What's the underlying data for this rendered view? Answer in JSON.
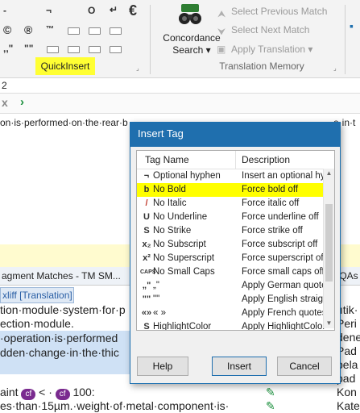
{
  "ribbon": {
    "quickinsert": {
      "label": "QuickInsert",
      "symbols_row1": [
        "-",
        "¬",
        "O",
        "↵",
        "€"
      ],
      "symbols_row2": [
        "©",
        "®",
        "™"
      ],
      "symbols_row3": [
        ",,\"",
        "\"\"",
        "«»"
      ]
    },
    "concordance": {
      "label_line1": "Concordance",
      "label_line2": "Search"
    },
    "translation_memory": {
      "label": "Translation Memory",
      "items": [
        "Select Previous Match",
        "Select Next Match",
        "Apply Translation"
      ]
    }
  },
  "editor": {
    "row_number": "2",
    "source_text": "on·is·performed·on·the·rear·b",
    "source_text_right": "e·in·t",
    "panel_title": "agment Matches - TM SM...",
    "panel_tab_right": "TQAs",
    "file_tab": "xliff [Translation]",
    "segments": [
      "tion·module·system·for·p",
      "ection·module.",
      "·operation·is·performed",
      "dden·change·in·the·thic",
      "aint",
      "es·than·15µm.·weight·of·metal·component·is·"
    ],
    "segment4_tags": [
      "cf",
      "<",
      "·",
      "cf",
      "100:"
    ],
    "right_column": [
      "tıtik·",
      "Peri",
      "dene",
      "Pad",
      "bela",
      "pad",
      "Kon",
      "Kate"
    ]
  },
  "dialog": {
    "title": "Insert Tag",
    "columns": [
      "Tag Name",
      "Description"
    ],
    "rows": [
      {
        "icon": "¬",
        "name": "Optional hyphen",
        "desc": "Insert an optional hyp"
      },
      {
        "icon": "b",
        "name": "No Bold",
        "desc": "Force bold off",
        "selected": true
      },
      {
        "icon": "/",
        "name": "No Italic",
        "desc": "Force italic off"
      },
      {
        "icon": "U",
        "name": "No Underline",
        "desc": "Force underline off"
      },
      {
        "icon": "S",
        "name": "No Strike",
        "desc": "Force strike off"
      },
      {
        "icon": "x₂",
        "name": "No Subscript",
        "desc": "Force subscript off"
      },
      {
        "icon": "x²",
        "name": "No Superscript",
        "desc": "Force superscript off"
      },
      {
        "icon": "CAPS",
        "name": "No Small Caps",
        "desc": "Force small caps off"
      },
      {
        "icon": "„\"",
        "name": "„\"",
        "desc": "Apply German quotes"
      },
      {
        "icon": "\"\"",
        "name": "\"\"",
        "desc": "Apply English straight"
      },
      {
        "icon": "«»",
        "name": "« »",
        "desc": "Apply French quotes"
      },
      {
        "icon": "S",
        "name": "HighlightColor",
        "desc": "Apply HighlightColor"
      }
    ],
    "buttons": {
      "help": "Help",
      "insert": "Insert",
      "cancel": "Cancel"
    }
  },
  "colors": {
    "title_bar": "#1f6fae",
    "highlight": "#ffff00",
    "tag_pill": "#7a2b8f"
  }
}
